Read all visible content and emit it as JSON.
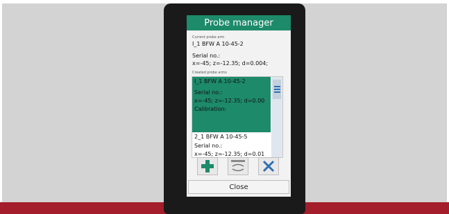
{
  "dialog": {
    "title": "Probe manager",
    "current_label": "Current probe arm",
    "current_name": "I_1 BFW A 10-45-2",
    "current_serial": "Serial no.:",
    "current_params": "x=-45; z=-12.35; d=0.004;",
    "created_label": "Created probe arms"
  },
  "list": {
    "selected": {
      "name": "I_1 BFW A 10-45-2",
      "serial": "Serial no.:",
      "params": "x=-45; z=-12.35; d=0.00",
      "calibration": "Calibration:"
    },
    "second": {
      "name": "2_1 BFW A 10-45-5",
      "serial": "Serial no.:",
      "params": "x=-45; z=-12.35; d=0.01"
    }
  },
  "buttons": {
    "add_icon": "plus-icon",
    "switch_icon": "switch-arm-icon",
    "delete_icon": "x-icon",
    "close_label": "Close"
  },
  "colors": {
    "accent": "#1d8a6a",
    "band": "#a31d2b"
  }
}
